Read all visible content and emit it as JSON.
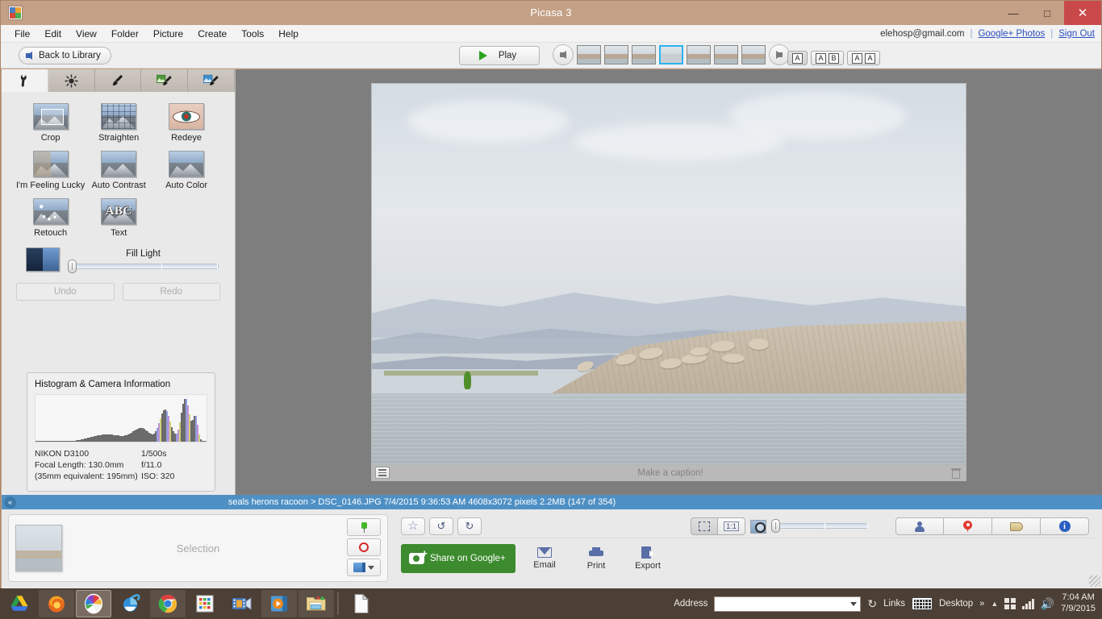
{
  "window": {
    "title": "Picasa 3",
    "app_icon": "picasa-logo",
    "minimize": "—",
    "maximize": "□",
    "close": "✕"
  },
  "menubar": {
    "items": [
      "File",
      "Edit",
      "View",
      "Folder",
      "Picture",
      "Create",
      "Tools",
      "Help"
    ],
    "account_email": "elehosp@gmail.com",
    "google_photos_link": "Google+ Photos",
    "sign_out_link": "Sign Out",
    "separator": "|"
  },
  "toolbar": {
    "back_to_library": "Back to Library",
    "play": "Play",
    "compare_modes": [
      {
        "label": "A",
        "name": "single-view",
        "active": true
      },
      {
        "label": "AB",
        "name": "side-by-side-view",
        "active": false
      },
      {
        "label": "AA",
        "name": "duplicate-view",
        "active": false
      }
    ],
    "filmstrip_selected_index": 3,
    "filmstrip_count": 7
  },
  "left_panel": {
    "tabs": [
      {
        "name": "basic-fixes",
        "icon": "wrench-icon",
        "active": true
      },
      {
        "name": "tuning",
        "icon": "sun-icon",
        "active": false
      },
      {
        "name": "effects",
        "icon": "brush-icon",
        "active": false
      },
      {
        "name": "effects-green",
        "icon": "green-brush-icon",
        "active": false
      },
      {
        "name": "effects-blue",
        "icon": "blue-brush-icon",
        "active": false
      }
    ],
    "tools": [
      {
        "label": "Crop",
        "icon": "crop-icon"
      },
      {
        "label": "Straighten",
        "icon": "straighten-icon"
      },
      {
        "label": "Redeye",
        "icon": "redeye-icon"
      },
      {
        "label": "I'm Feeling Lucky",
        "icon": "feeling-lucky-icon"
      },
      {
        "label": "Auto Contrast",
        "icon": "auto-contrast-icon"
      },
      {
        "label": "Auto Color",
        "icon": "auto-color-icon"
      },
      {
        "label": "Retouch",
        "icon": "retouch-icon"
      },
      {
        "label": "Text",
        "icon": "text-icon"
      }
    ],
    "fill_light": {
      "label": "Fill Light",
      "value": 0,
      "icon": "fill-light-icon"
    },
    "undo_label": "Undo",
    "redo_label": "Redo",
    "histogram": {
      "title": "Histogram & Camera Information",
      "camera": "NIKON D3100",
      "shutter": "1/500s",
      "focal_length": "Focal Length: 130.0mm",
      "aperture": "f/11.0",
      "equivalent": "(35mm equivalent: 195mm)",
      "iso": "ISO: 320"
    }
  },
  "photo": {
    "caption_placeholder": "Make a caption!",
    "caption_icon": "caption-lines-icon",
    "delete_icon": "trash-icon"
  },
  "statusbar": {
    "collapse_icon": "«",
    "text": "seals herons racoon > DSC_0146.JPG   7/4/2015 9:36:53 AM   4608x3072 pixels   2.2MB   (147 of 354)"
  },
  "tray": {
    "label": "Selection",
    "pin_icon": "green-pin-icon",
    "circle_icon": "red-circle-icon",
    "album_icon": "blue-album-icon"
  },
  "actions": {
    "star_icon": "star-icon",
    "rotate_left_icon": "rotate-ccw-icon",
    "rotate_right_icon": "rotate-cw-icon",
    "fit_label": "fit-to-window",
    "one_to_one_label": "1:1",
    "zoom_icon": "zoom-photo-icon",
    "zoom_value": 0,
    "share_label": "Share on Google+",
    "email_label": "Email",
    "print_label": "Print",
    "export_label": "Export",
    "right_icons": [
      {
        "name": "people-icon"
      },
      {
        "name": "places-icon"
      },
      {
        "name": "tags-icon"
      },
      {
        "name": "info-icon",
        "glyph": "i"
      }
    ]
  },
  "taskbar": {
    "apps": [
      {
        "name": "google-drive-icon"
      },
      {
        "name": "firefox-icon"
      },
      {
        "name": "picasa-icon",
        "active": true
      },
      {
        "name": "internet-explorer-icon"
      },
      {
        "name": "chrome-icon"
      },
      {
        "name": "app-grid-icon"
      },
      {
        "name": "movie-maker-icon"
      },
      {
        "name": "media-player-icon"
      },
      {
        "name": "file-explorer-icon"
      },
      {
        "name": "document-icon"
      }
    ],
    "address_label": "Address",
    "address_value": "",
    "links_label": "Links",
    "desktop_label": "Desktop",
    "overflow": "»",
    "tray_chevron": "▲",
    "time": "7:04 AM",
    "date": "7/9/2015"
  }
}
